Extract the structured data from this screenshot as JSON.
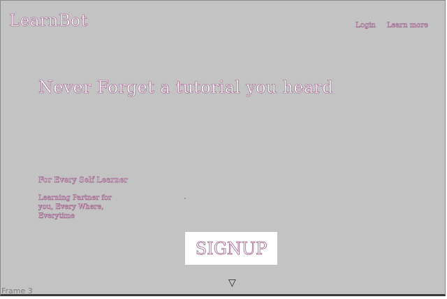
{
  "header": {
    "brand": "LearnBot",
    "nav": {
      "login_label": "Login",
      "learn_more_label": "Learn more"
    }
  },
  "hero": {
    "title": "Never Forget a tutorial you heard",
    "subheading": "For Every Self Learner",
    "description": "Learning Partner for you, Every Where, Everytime"
  },
  "cta": {
    "signup_label": "SIGNUP"
  },
  "scroll_indicator": {
    "glyph": "▽",
    "icon": "triangle-down-icon"
  },
  "frame": {
    "label": "Frame 3"
  },
  "colors": {
    "background": "#c3c3c3",
    "text_outline": "#a06a8f",
    "text_fill": "#ffffff",
    "button_bg": "#ffffff"
  }
}
